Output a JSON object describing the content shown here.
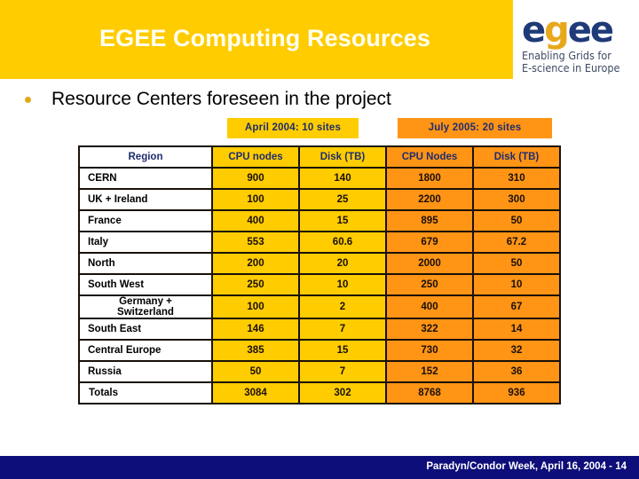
{
  "header": {
    "title": "EGEE Computing Resources",
    "band_color": "#FFCC00",
    "title_color": "#FFFFF0"
  },
  "logo": {
    "wordmark_part1": "e",
    "wordmark_part2": "g",
    "wordmark_part3": "ee",
    "tagline_line1": "Enabling Grids for",
    "tagline_line2": "E-science in Europe",
    "navy_color": "#1F3A78",
    "gold_color": "#E8A81B"
  },
  "bullet": {
    "text": "Resource Centers foreseen in the project",
    "dot_color": "#E0A91A"
  },
  "badges": {
    "april": "April 2004: 10 sites",
    "july": "July 2005: 20 sites",
    "april_color": "#FFCC00",
    "july_color": "#FF9415"
  },
  "table": {
    "headers": {
      "region": "Region",
      "april_cpu": "CPU nodes",
      "april_disk": "Disk (TB)",
      "july_cpu": "CPU Nodes",
      "july_disk": "Disk (TB)"
    },
    "rows": [
      {
        "region": "CERN",
        "april_cpu": "900",
        "april_disk": "140",
        "july_cpu": "1800",
        "july_disk": "310"
      },
      {
        "region": "UK + Ireland",
        "april_cpu": "100",
        "april_disk": "25",
        "july_cpu": "2200",
        "july_disk": "300"
      },
      {
        "region": "France",
        "april_cpu": "400",
        "april_disk": "15",
        "july_cpu": "895",
        "july_disk": "50"
      },
      {
        "region": "Italy",
        "april_cpu": "553",
        "april_disk": "60.6",
        "july_cpu": "679",
        "july_disk": "67.2"
      },
      {
        "region": "North",
        "april_cpu": "200",
        "april_disk": "20",
        "july_cpu": "2000",
        "july_disk": "50"
      },
      {
        "region": "South West",
        "april_cpu": "250",
        "april_disk": "10",
        "july_cpu": "250",
        "july_disk": "10"
      },
      {
        "region": "Germany +\nSwitzerland",
        "april_cpu": "100",
        "april_disk": "2",
        "july_cpu": "400",
        "july_disk": "67"
      },
      {
        "region": "South East",
        "april_cpu": "146",
        "april_disk": "7",
        "july_cpu": "322",
        "july_disk": "14"
      },
      {
        "region": "Central Europe",
        "april_cpu": "385",
        "april_disk": "15",
        "july_cpu": "730",
        "july_disk": "32"
      },
      {
        "region": "Russia",
        "april_cpu": "50",
        "april_disk": "7",
        "july_cpu": "152",
        "july_disk": "36"
      }
    ],
    "totals": {
      "region": "Totals",
      "april_cpu": "3084",
      "april_disk": "302",
      "july_cpu": "8768",
      "july_disk": "936"
    }
  },
  "footer": {
    "text": "Paradyn/Condor Week, April 16, 2004 - 14",
    "bar_color": "#0E0E7A"
  },
  "chart_data": {
    "type": "table",
    "title": "EGEE Computing Resources — Resource Centers foreseen in the project",
    "column_groups": [
      "April 2004: 10 sites",
      "July 2005: 20 sites"
    ],
    "columns": [
      "Region",
      "CPU nodes",
      "Disk (TB)",
      "CPU Nodes",
      "Disk (TB)"
    ],
    "rows": [
      [
        "CERN",
        900,
        140,
        1800,
        310
      ],
      [
        "UK + Ireland",
        100,
        25,
        2200,
        300
      ],
      [
        "France",
        400,
        15,
        895,
        50
      ],
      [
        "Italy",
        553,
        60.6,
        679,
        67.2
      ],
      [
        "North",
        200,
        20,
        2000,
        50
      ],
      [
        "South West",
        250,
        10,
        250,
        10
      ],
      [
        "Germany + Switzerland",
        100,
        2,
        400,
        67
      ],
      [
        "South East",
        146,
        7,
        322,
        14
      ],
      [
        "Central Europe",
        385,
        15,
        730,
        32
      ],
      [
        "Russia",
        50,
        7,
        152,
        36
      ]
    ],
    "totals": [
      "Totals",
      3084,
      302,
      8768,
      936
    ]
  }
}
